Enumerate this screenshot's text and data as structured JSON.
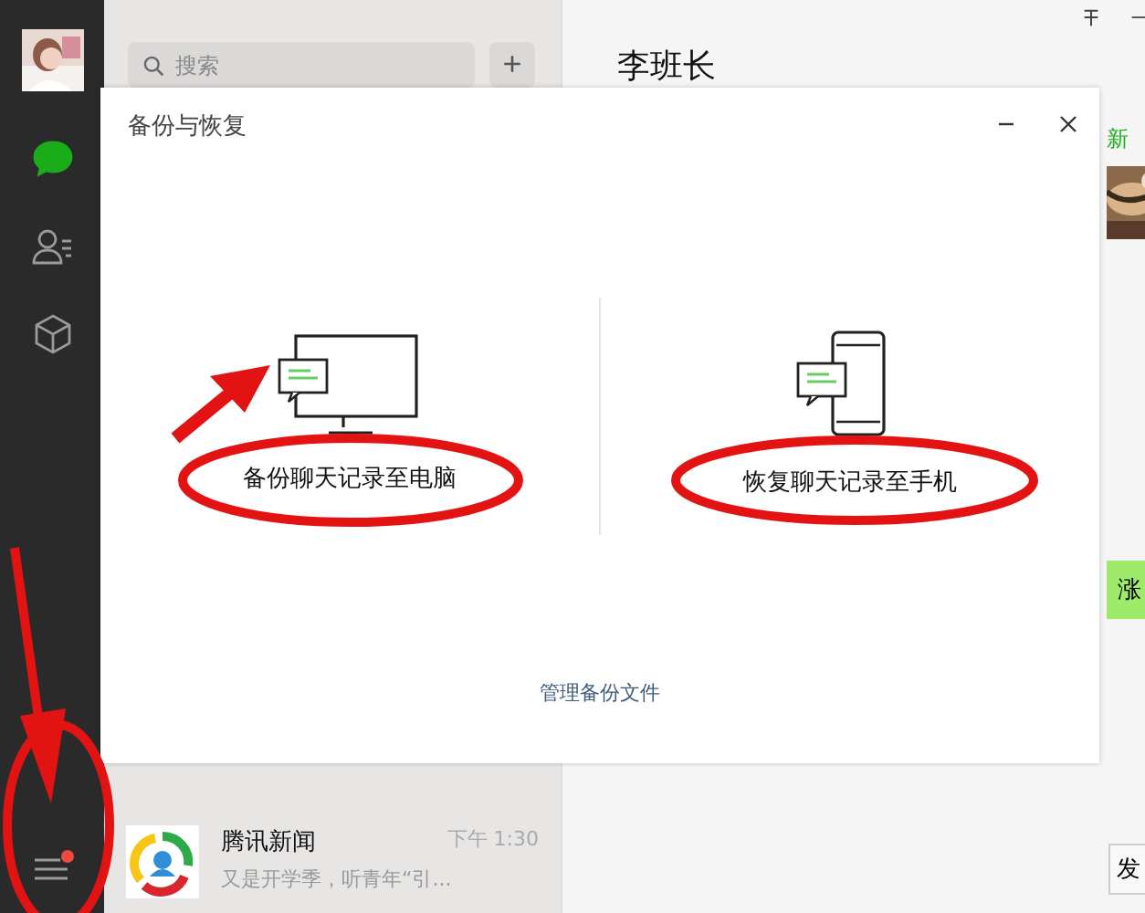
{
  "sidebar": {
    "nav": [
      {
        "kind": "chat",
        "selected": true
      },
      {
        "kind": "contacts",
        "selected": false
      },
      {
        "kind": "cube",
        "selected": false
      }
    ],
    "menu_badge": true
  },
  "chat_list": {
    "search": {
      "placeholder": "搜索"
    },
    "add_button": "+",
    "conversations": [
      {
        "name": "腾讯新闻",
        "time": "下午 1:30",
        "preview": "又是开学季，听青年“引..."
      }
    ]
  },
  "chat": {
    "title": "李班长",
    "messages": [
      {
        "kind": "text",
        "text": "新"
      },
      {
        "kind": "picture"
      },
      {
        "kind": "bubble",
        "text": "涨"
      }
    ],
    "send_button": "发"
  },
  "dialog": {
    "title": "备份与恢复",
    "options": [
      {
        "kind": "computer",
        "label": "备份聊天记录至电脑"
      },
      {
        "kind": "phone",
        "label": "恢复聊天记录至手机"
      }
    ],
    "link": "管理备份文件"
  }
}
